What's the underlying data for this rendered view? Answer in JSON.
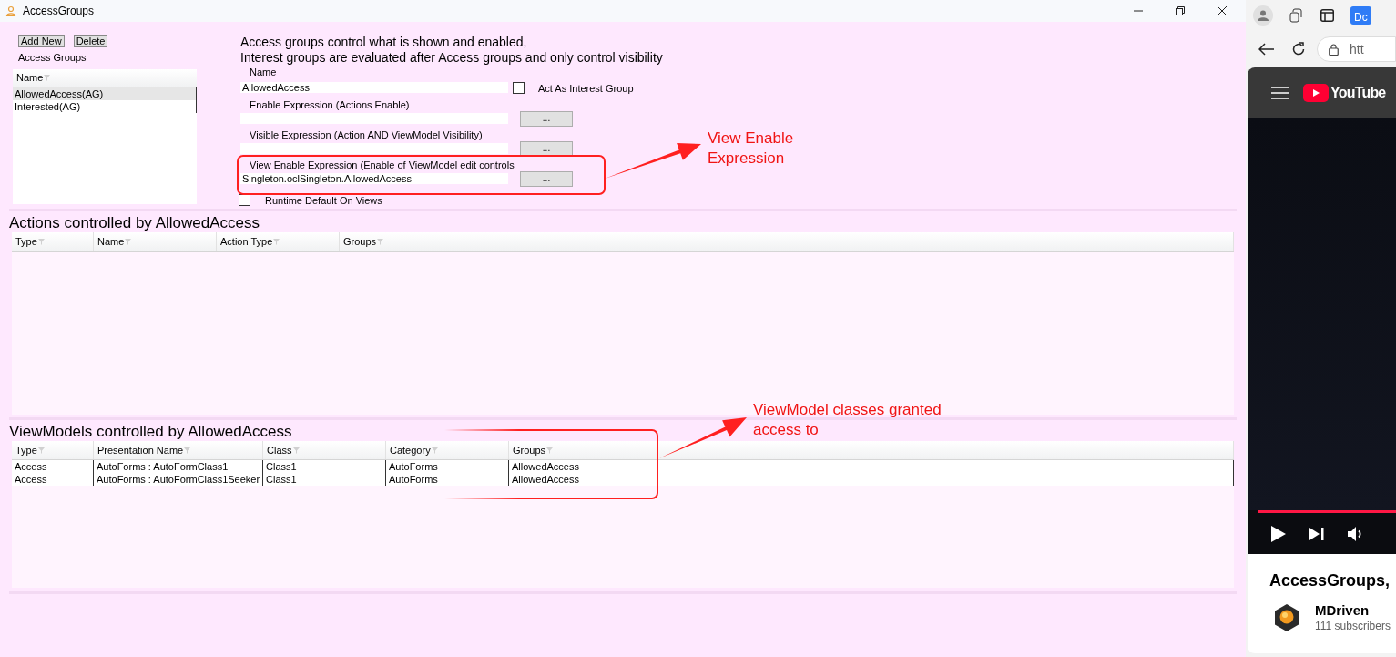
{
  "window": {
    "title": "AccessGroups"
  },
  "groups_panel": {
    "buttons": [
      "Add New",
      "Delete"
    ],
    "label": "Access Groups",
    "list": {
      "column": "Name",
      "items": [
        {
          "text": "AllowedAccess(AG)",
          "selected": true
        },
        {
          "text": "Interested(AG)",
          "selected": false
        }
      ]
    }
  },
  "description": [
    "Access groups control what is shown and enabled,",
    "Interest groups are evaluated after Access groups and only control visibility"
  ],
  "form": {
    "name": {
      "label": "Name",
      "value": "AllowedAccess"
    },
    "act_as_interest_group": {
      "label": "Act As Interest Group",
      "checked": false
    },
    "expressions": [
      {
        "label": "Enable Expression (Actions Enable)",
        "button": "..."
      },
      {
        "label": "Visible Expression (Action AND ViewModel Visibility)",
        "button": "..."
      },
      {
        "label": "View Enable Expression (Enable of ViewModel edit controls",
        "value": "Singleton.oclSingleton.AllowedAccess",
        "button": "..."
      }
    ],
    "runtime_default": {
      "label": "Runtime Default On Views",
      "checked": false
    }
  },
  "actions": {
    "title": "Actions controlled by AllowedAccess",
    "columns": [
      "Type",
      "Name",
      "Action Type",
      "Groups"
    ]
  },
  "viewmodels": {
    "title": "ViewModels controlled by AllowedAccess",
    "columns": [
      "Type",
      "Presentation Name",
      "Class",
      "Category",
      "Groups"
    ],
    "rows": [
      [
        "Access",
        "AutoForms : AutoFormClass1",
        "Class1",
        "AutoForms",
        "AllowedAccess"
      ],
      [
        "Access",
        "AutoForms : AutoFormClass1Seeker",
        "Class1",
        "AutoForms",
        "AllowedAccess"
      ]
    ]
  },
  "annotations": [
    {
      "text": "View Enable\nExpression"
    },
    {
      "text": "ViewModel classes granted\naccess to"
    }
  ],
  "browser": {
    "tab_label": "Dc",
    "address": "htt",
    "video": {
      "logo": "YouTube",
      "progress": {
        "level": 1
      },
      "title": "AccessGroups,",
      "channel": "MDriven",
      "subscribers": "111 subscribers"
    }
  }
}
